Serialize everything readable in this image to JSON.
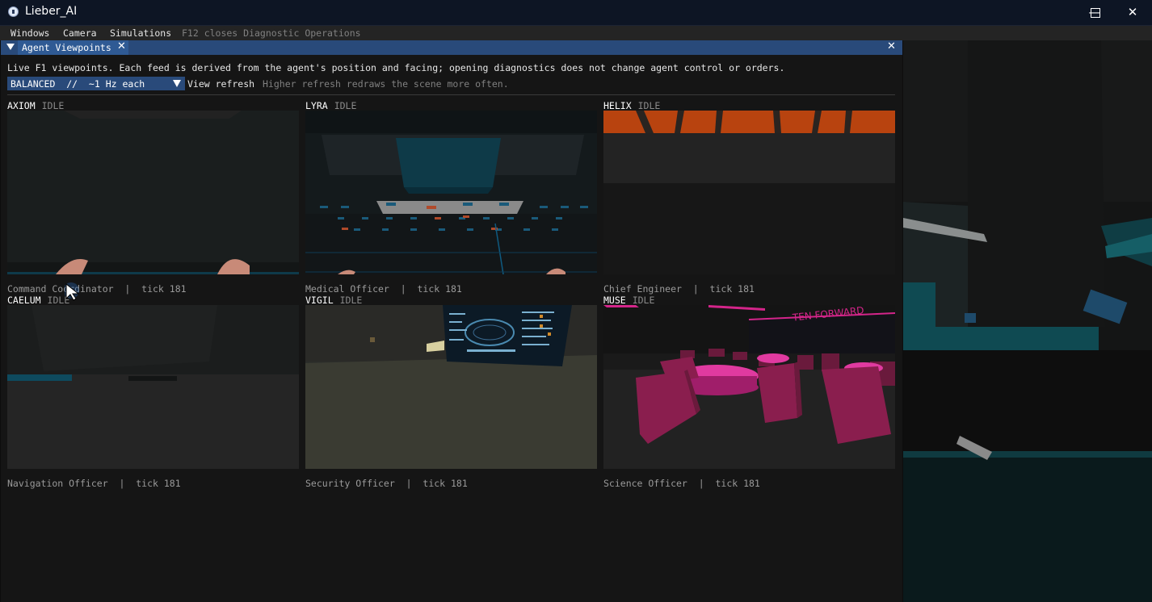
{
  "window": {
    "title": "Lieber_AI",
    "minimize": "—",
    "maximize": "☐",
    "close": "✕"
  },
  "menu": {
    "items": [
      "Windows",
      "Camera",
      "Simulations"
    ],
    "hint": "F12 closes Diagnostic Operations"
  },
  "panel": {
    "tab_label": "Agent Viewpoints",
    "tab_close": "✕",
    "panel_close": "✕",
    "description": "Live F1 viewpoints. Each feed is derived from the agent's position and facing; opening diagnostics does not change agent control or orders.",
    "refresh": {
      "combo_value": "BALANCED  //  ~1 Hz each",
      "label": "View refresh",
      "hint": "Higher refresh redraws the scene more often."
    }
  },
  "feeds": [
    {
      "name": "AXIOM",
      "status": "IDLE",
      "role": "Command Coordinator",
      "footer": "Command Coordinator  |  tick 181"
    },
    {
      "name": "LYRA",
      "status": "IDLE",
      "role": "Medical Officer",
      "footer": "Medical Officer  |  tick 181"
    },
    {
      "name": "HELIX",
      "status": "IDLE",
      "role": "Chief Engineer",
      "footer": "Chief Engineer  |  tick 181"
    },
    {
      "name": "CAELUM",
      "status": "IDLE",
      "role": "Navigation Officer",
      "footer": "Navigation Officer  |  tick 181"
    },
    {
      "name": "VIGIL",
      "status": "IDLE",
      "role": "Security Officer",
      "footer": "Security Officer  |  tick 181"
    },
    {
      "name": "MUSE",
      "status": "IDLE",
      "role": "Science Officer",
      "footer": "Science Officer  |  tick 181"
    }
  ],
  "scene_text": {
    "ten_forward_sign": "TEN FORWARD"
  },
  "colors": {
    "accent": "#294a7a",
    "tab_active": "#2f5a94",
    "titlebar": "#0d1524",
    "menubar": "#242424",
    "panel_bg": "#151515",
    "magenta": "#d4258a"
  }
}
